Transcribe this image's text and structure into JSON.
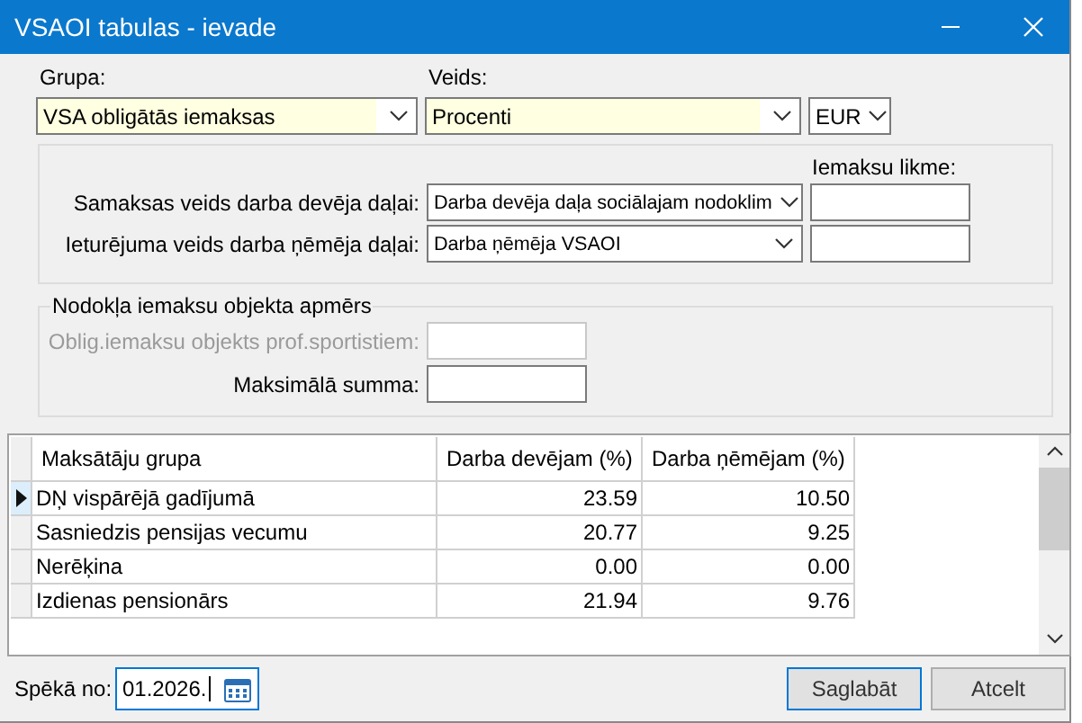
{
  "window": {
    "title": "VSAOI tabulas - ievade"
  },
  "grupa": {
    "label": "Grupa:",
    "value": "VSA obligātās iemaksas",
    "required": true
  },
  "veids": {
    "label": "Veids:",
    "value": "Procenti",
    "required": true
  },
  "currency": {
    "value": "EUR",
    "required": false
  },
  "payment_types": {
    "rate_header": "Iemaksu likme:",
    "rows": [
      {
        "label": "Samaksas veids darba devēja daļai:",
        "value": "Darba devēja daļa sociālajam nodoklim"
      },
      {
        "label": "Ieturējuma veids darba ņēmēja daļai:",
        "value": "Darba ņēmēja VSAOI"
      }
    ]
  },
  "tax_object": {
    "legend": "Nodokļa iemaksu objekta apmērs",
    "rows": [
      {
        "label": "Oblig.iemaksu objekts prof.sportistiem:",
        "disabled": true
      },
      {
        "label": "Maksimālā summa:",
        "disabled": false
      }
    ]
  },
  "table": {
    "columns": [
      "Maksātāju grupa",
      "Darba devējam (%)",
      "Darba ņēmējam (%)"
    ],
    "rows": [
      {
        "cells": [
          "DŅ vispārējā gadījumā",
          "23.59",
          "10.50"
        ],
        "selected": true
      },
      {
        "cells": [
          "Sasniedzis pensijas vecumu",
          "20.77",
          "9.25"
        ],
        "selected": false
      },
      {
        "cells": [
          "Nerēķina",
          "0.00",
          "0.00"
        ],
        "selected": false
      },
      {
        "cells": [
          "Izdienas pensionārs",
          "21.94",
          "9.76"
        ],
        "selected": false
      }
    ]
  },
  "effective_from": {
    "label": "Spēkā no:",
    "value": "01.2026."
  },
  "buttons": [
    {
      "label": "Saglabāt",
      "default": true
    },
    {
      "label": "Atcelt",
      "default": false
    }
  ]
}
